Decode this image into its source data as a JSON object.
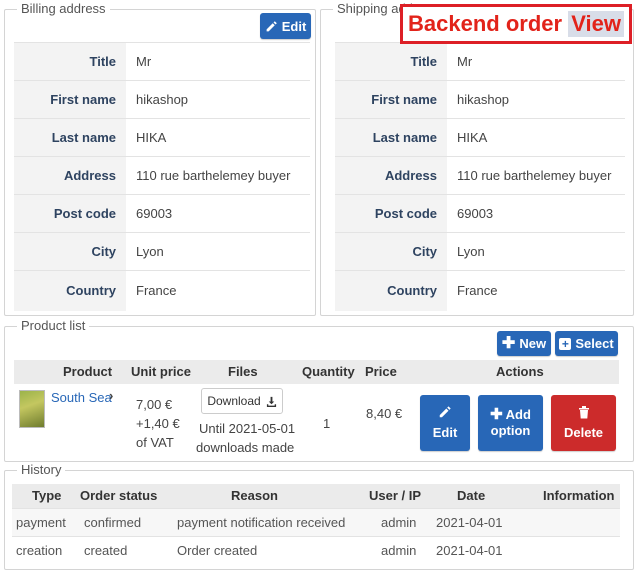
{
  "billing": {
    "legend": "Billing address",
    "edit_label": "Edit",
    "rows": [
      {
        "label": "Title",
        "value": "Mr"
      },
      {
        "label": "First name",
        "value": "hikashop"
      },
      {
        "label": "Last name",
        "value": "HIKA"
      },
      {
        "label": "Address",
        "value": "110 rue barthelemey buyer"
      },
      {
        "label": "Post code",
        "value": "69003"
      },
      {
        "label": "City",
        "value": "Lyon"
      },
      {
        "label": "Country",
        "value": "France"
      }
    ]
  },
  "shipping": {
    "legend": "Shipping address",
    "rows": [
      {
        "label": "Title",
        "value": "Mr"
      },
      {
        "label": "First name",
        "value": "hikashop"
      },
      {
        "label": "Last name",
        "value": "HIKA"
      },
      {
        "label": "Address",
        "value": "110 rue barthelemey buyer"
      },
      {
        "label": "Post code",
        "value": "69003"
      },
      {
        "label": "City",
        "value": "Lyon"
      },
      {
        "label": "Country",
        "value": "France"
      }
    ]
  },
  "badge": {
    "text_main": "Backend order",
    "text_highlight": "View"
  },
  "products": {
    "legend": "Product list",
    "new_label": "New",
    "select_label": "Select",
    "headers": {
      "product": "Product",
      "unit_price": "Unit price",
      "files": "Files",
      "quantity": "Quantity",
      "price": "Price",
      "actions": "Actions"
    },
    "item": {
      "name": "South Sea",
      "unit_price_line1": "7,00 €",
      "unit_price_line2": "+1,40 €",
      "unit_price_line3": "of VAT",
      "download_label": "Download",
      "file_note_line1": "Until 2021-05-01",
      "file_note_line2": "downloads made",
      "quantity": "1",
      "price": "8,40 €",
      "edit_label": "Edit",
      "add_option_line1": "Add",
      "add_option_line2": "option",
      "delete_label": "Delete"
    }
  },
  "history": {
    "legend": "History",
    "headers": {
      "type": "Type",
      "status": "Order status",
      "reason": "Reason",
      "user": "User / IP",
      "date": "Date",
      "info": "Information"
    },
    "rows": [
      {
        "type": "payment",
        "status": "confirmed",
        "reason": "payment notification received",
        "user": "admin",
        "date": "2021-04-01",
        "info": ""
      },
      {
        "type": "creation",
        "status": "created",
        "reason": "Order created",
        "user": "admin",
        "date": "2021-04-01",
        "info": ""
      }
    ]
  },
  "colors": {
    "blue": "#2867b7",
    "red": "#cc2b2b",
    "badge_red": "#e2231a"
  }
}
